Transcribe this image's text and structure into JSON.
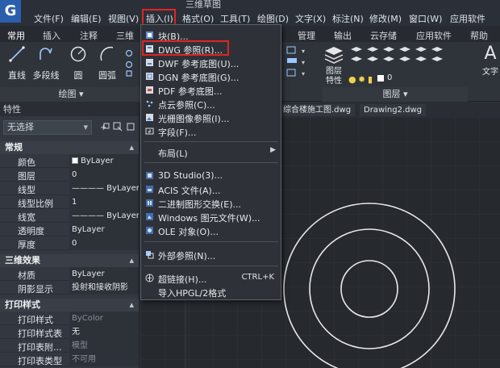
{
  "app": {
    "logo_letter": "G",
    "window_title": "三维草图"
  },
  "menubar": [
    {
      "label": "文件(F)"
    },
    {
      "label": "编辑(E)"
    },
    {
      "label": "视图(V)"
    },
    {
      "label": "插入(I)"
    },
    {
      "label": "格式(O)"
    },
    {
      "label": "工具(T)"
    },
    {
      "label": "绘图(D)"
    },
    {
      "label": "文字(X)"
    },
    {
      "label": "标注(N)"
    },
    {
      "label": "修改(M)"
    },
    {
      "label": "窗口(W)"
    },
    {
      "label": "应用软件"
    }
  ],
  "ribbon_tabs": [
    {
      "label": "常用"
    },
    {
      "label": "插入"
    },
    {
      "label": "注释"
    },
    {
      "label": "三维"
    },
    {
      "label": "管理"
    },
    {
      "label": "输出"
    },
    {
      "label": "云存储"
    },
    {
      "label": "应用软件"
    },
    {
      "label": "帮助"
    }
  ],
  "ribbon": {
    "draw_tools": [
      {
        "label": "直线",
        "icon": "line-icon"
      },
      {
        "label": "多段线",
        "icon": "polyline-icon"
      },
      {
        "label": "圆",
        "icon": "circle-icon"
      },
      {
        "label": "圆弧",
        "icon": "arc-icon"
      }
    ],
    "draw_group": "绘图",
    "layer_tool": "图层\n特性",
    "layer_value": "0",
    "layer_group": "图层",
    "text_tool": "文字",
    "text_letter": "A"
  },
  "properties": {
    "header": "特性",
    "selection": "无选择",
    "sections": {
      "general": "常规",
      "three_d": "三维效果",
      "print": "打印样式"
    },
    "general_rows": [
      {
        "key": "颜色",
        "value": "ByLayer"
      },
      {
        "key": "图层",
        "value": "0"
      },
      {
        "key": "线型",
        "value": "———— ByLayer"
      },
      {
        "key": "线型比例",
        "value": "1"
      },
      {
        "key": "线宽",
        "value": "———— ByLayer"
      },
      {
        "key": "透明度",
        "value": "ByLayer"
      },
      {
        "key": "厚度",
        "value": "0"
      }
    ],
    "three_d_rows": [
      {
        "key": "材质",
        "value": "ByLayer"
      },
      {
        "key": "阴影显示",
        "value": "投射和接收阴影"
      }
    ],
    "print_rows": [
      {
        "key": "打印样式",
        "value": "ByColor"
      },
      {
        "key": "打印样式表",
        "value": "无"
      },
      {
        "key": "打印表附...",
        "value": "模型"
      },
      {
        "key": "打印表类型",
        "value": "不可用"
      }
    ]
  },
  "doc_tabs": [
    {
      "label": "综合楼施工图.dwg"
    },
    {
      "label": "Drawing2.dwg"
    }
  ],
  "insert_menu": {
    "items": [
      {
        "label": "块(B)...",
        "icon": "block-icon"
      },
      {
        "label": "DWG 参照(R)...",
        "icon": "dwg-ref-icon"
      },
      {
        "label": "DWF 参考底图(U)...",
        "icon": "dwf-icon"
      },
      {
        "label": "DGN 参考底图(G)...",
        "icon": "dgn-icon"
      },
      {
        "label": "PDF 参考底图...",
        "icon": "pdf-icon"
      },
      {
        "label": "点云参照(C)...",
        "icon": "pointcloud-icon"
      },
      {
        "label": "光栅图像参照(I)...",
        "icon": "raster-icon"
      },
      {
        "label": "字段(F)...",
        "icon": "field-icon"
      },
      {
        "label": "布局(L)",
        "icon": ""
      },
      {
        "label": "3D Studio(3)...",
        "icon": "3ds-icon"
      },
      {
        "label": "ACIS 文件(A)...",
        "icon": "acis-icon"
      },
      {
        "label": "二进制图形交换(E)...",
        "icon": "dxb-icon"
      },
      {
        "label": "Windows 图元文件(W)...",
        "icon": "wmf-icon"
      },
      {
        "label": "OLE 对象(O)...",
        "icon": "ole-icon"
      },
      {
        "label": "外部参照(N)...",
        "icon": "xref-icon"
      },
      {
        "label": "超链接(H)...",
        "icon": "hyperlink-icon"
      },
      {
        "label": "导入HPGL/2格式",
        "icon": ""
      }
    ],
    "hyperlink_shortcut": "CTRL+K",
    "submenu_arrow": "▶"
  },
  "colors": {
    "highlight_box": "#e02424",
    "circle_stroke": "#e8e8e8"
  }
}
